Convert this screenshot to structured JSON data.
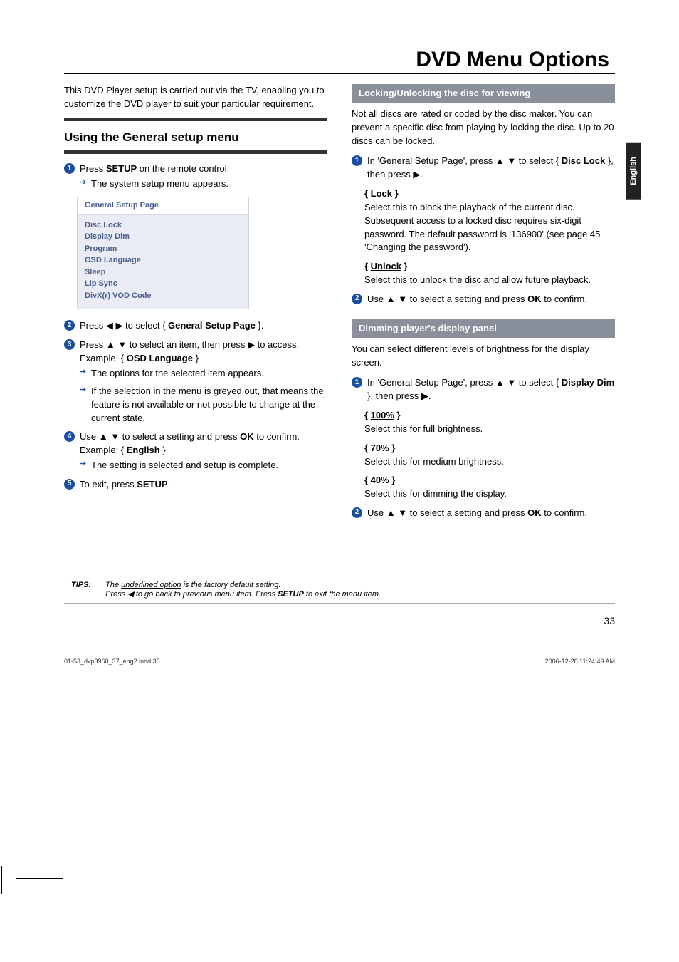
{
  "pageNumber": "33",
  "languageTab": "English",
  "mainTitle": "DVD Menu Options",
  "intro": "This DVD Player setup is carried out via the TV, enabling you to customize the DVD player to suit your particular requirement.",
  "general": {
    "heading": "Using the General setup menu",
    "step1_a": "Press ",
    "step1_setup": "SETUP",
    "step1_b": " on the remote control.",
    "step1_arrow": "The system setup menu appears.",
    "menuHeader": "General Setup Page",
    "menuItems": [
      "Disc Lock",
      "Display Dim",
      "Program",
      "OSD Language",
      "Sleep",
      "Lip Sync",
      "DivX(r) VOD Code"
    ],
    "step2_a": "Press ◀ ▶ to select { ",
    "step2_bold": "General Setup Page",
    "step2_b": " }.",
    "step3_a": "Press ▲ ▼ to select an item, then press ▶ to access.",
    "step3_ex_a": "Example: { ",
    "step3_ex_bold": "OSD Language",
    "step3_ex_b": " }",
    "step3_arrow1": "The options for the selected item appears.",
    "step3_arrow2": "If the selection in the menu is greyed out, that means the feature is not available or not possible to change at the current state.",
    "step4_a": "Use ▲ ▼ to select a setting and press ",
    "step4_ok": "OK",
    "step4_b": " to confirm.",
    "step4_ex_a": "Example: { ",
    "step4_ex_bold": "English",
    "step4_ex_b": " }",
    "step4_arrow": "The setting is selected and setup is complete.",
    "step5_a": "To exit, press ",
    "step5_setup": "SETUP",
    "step5_b": "."
  },
  "lock": {
    "bar": "Locking/Unlocking the disc for viewing",
    "intro": "Not all discs are rated or coded by the disc maker. You can prevent a specific disc from playing by locking the disc. Up to 20 discs can be locked.",
    "step1_a": "In 'General Setup Page', press ▲ ▼ to select { ",
    "step1_bold": "Disc Lock",
    "step1_b": " }, then press ▶.",
    "optLock_label": "{ Lock }",
    "optLock_text": "Select this to block the playback of the current disc. Subsequent access to a locked disc requires six-digit password. The default password is '136900' (see page 45 'Changing the password').",
    "optUnlock_label_a": "{ ",
    "optUnlock_label_u": "Unlock",
    "optUnlock_label_b": " }",
    "optUnlock_text": "Select this to unlock the disc and allow future playback.",
    "step2_a": "Use ▲ ▼ to select a setting and press ",
    "step2_ok": "OK",
    "step2_b": " to confirm."
  },
  "dim": {
    "bar": "Dimming player's display panel",
    "intro": "You can select different levels of brightness for the display screen.",
    "step1_a": "In 'General Setup Page', press ▲ ▼ to select { ",
    "step1_bold": "Display Dim",
    "step1_b": " }, then press ▶.",
    "opt100_label_a": "{ ",
    "opt100_label_u": "100%",
    "opt100_label_b": " }",
    "opt100_text": "Select this for full brightness.",
    "opt70_label": "{ 70% }",
    "opt70_text": "Select this for medium brightness.",
    "opt40_label": "{ 40% }",
    "opt40_text": "Select this for dimming the display.",
    "step2_a": "Use ▲ ▼ to select a setting and press ",
    "step2_ok": "OK",
    "step2_b": " to confirm."
  },
  "tips": {
    "label": "TIPS:",
    "line1_a": "The ",
    "line1_u": "underlined option",
    "line1_b": " is the factory default setting.",
    "line2_a": "Press ◀ to go back to previous menu item. Press ",
    "line2_setup": "SETUP",
    "line2_b": " to exit the menu item."
  },
  "footer": {
    "left": "01-53_dvp3960_37_eng2.indd   33",
    "right": "2006-12-28   11:24:49 AM"
  }
}
